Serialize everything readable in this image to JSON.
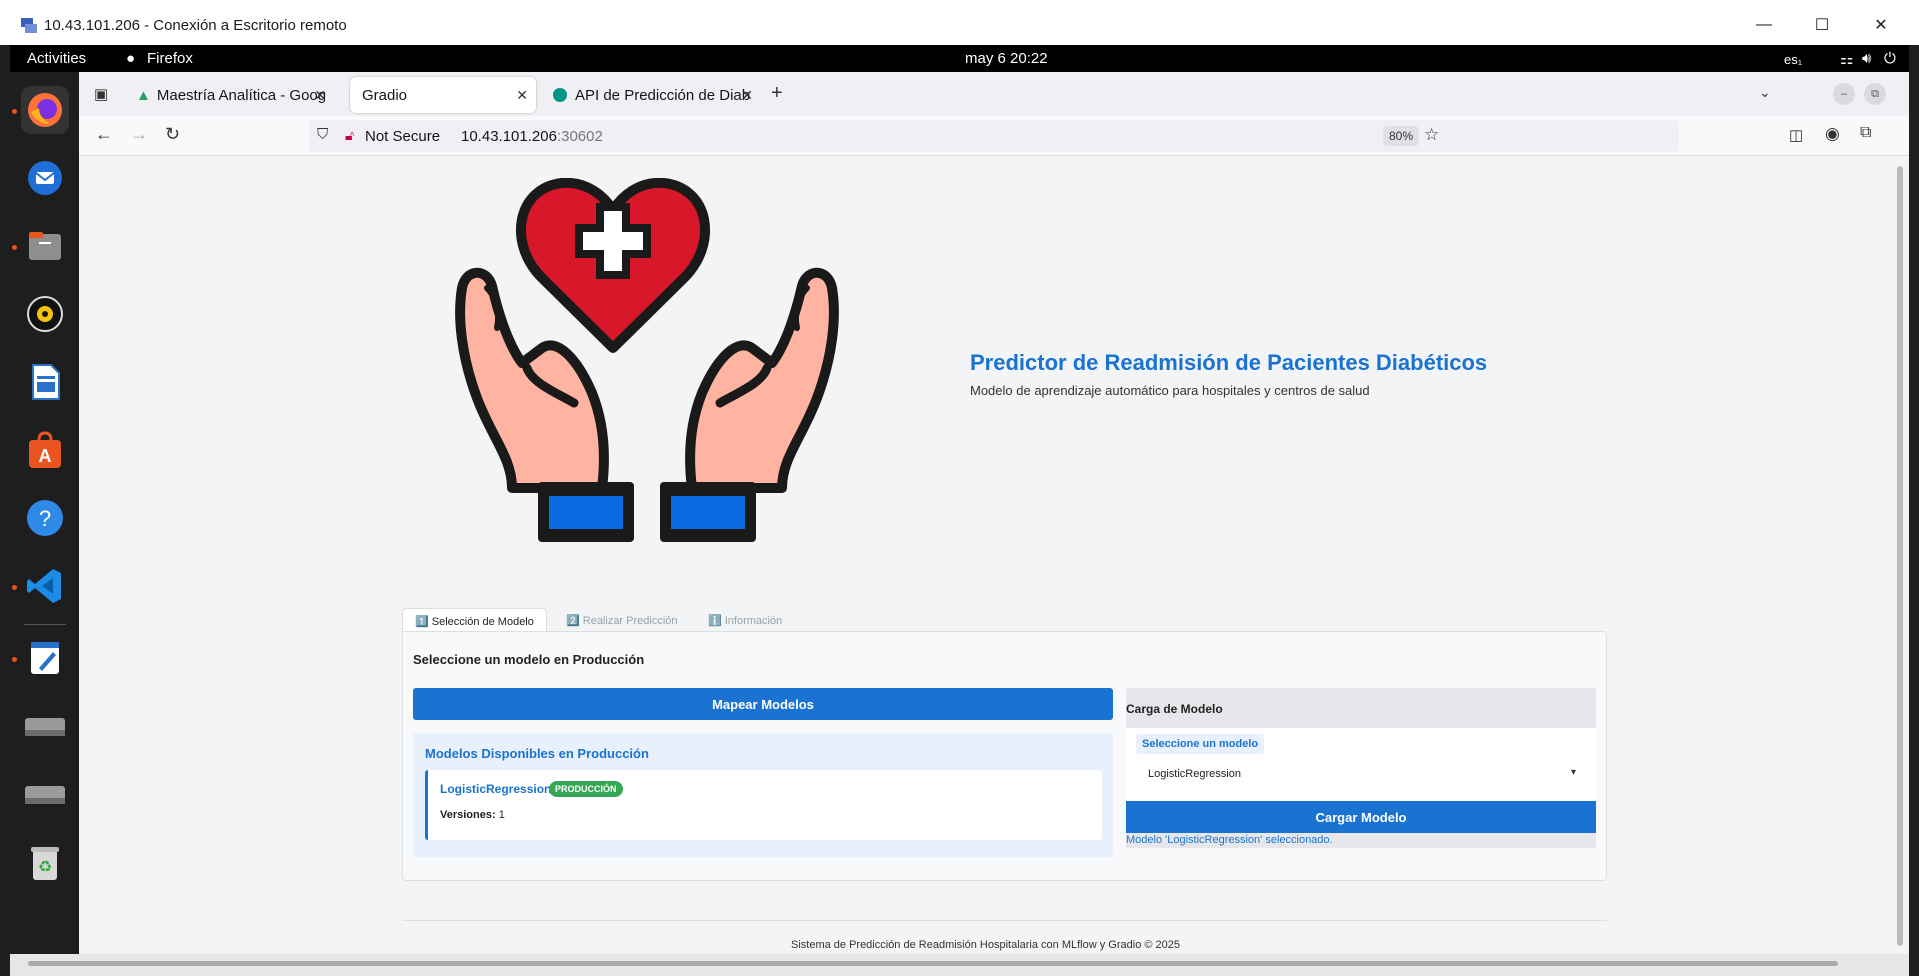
{
  "rdp": {
    "title": "10.43.101.206 - Conexión a Escritorio remoto",
    "minimize": "—",
    "maximize": "☐",
    "close": "✕"
  },
  "gnome": {
    "activities": "Activities",
    "app": "Firefox",
    "clock": "may 6  20:22",
    "lang": "es₁"
  },
  "dock": {
    "items": [
      "firefox-icon",
      "thunderbird-icon",
      "files-icon",
      "rhythmbox-icon",
      "libreoffice-writer-icon",
      "app-center-icon",
      "help-icon",
      "vscode-icon",
      "text-editor-icon",
      "drive-icon",
      "drive-icon",
      "trash-icon"
    ]
  },
  "browser": {
    "tabs": [
      {
        "label": "Maestría Analítica - Goog",
        "icon": "google-drive-icon"
      },
      {
        "label": "Gradio",
        "icon": ""
      },
      {
        "label": "API de Predicción de Diab",
        "icon": "fastapi-icon"
      }
    ],
    "new_tab": "+",
    "security": "Not Secure",
    "url_host": "10.43.101.206",
    "url_port": ":30602",
    "zoom": "80%"
  },
  "header": {
    "title": "Predictor de Readmisión de Pacientes Diabéticos",
    "subtitle": "Modelo de aprendizaje automático para hospitales y centros de salud",
    "logo": "heart-hands-logo"
  },
  "tabs": [
    "1️⃣ Selección de Modelo",
    "2️⃣ Realizar Predicción",
    "ℹ️ Información"
  ],
  "selection": {
    "heading": "Seleccione un modelo en Producción",
    "map_button": "Mapear Modelos",
    "available_title": "Modelos Disponibles en Producción",
    "model_name": "LogisticRegression",
    "badge": "PRODUCCIÓN",
    "versions_label": "Versiones:",
    "versions_value": "1"
  },
  "load": {
    "title": "Carga de Modelo",
    "select_label": "Seleccione un modelo",
    "select_value": "LogisticRegression",
    "button": "Cargar Modelo",
    "status": "Modelo 'LogisticRegression' seleccionado."
  },
  "footer": "Sistema de Predicción de Readmisión Hospitalaria con MLflow y Gradio © 2025",
  "colors": {
    "accent": "#1a73d1",
    "badge": "#34a853",
    "heart": "#d9172b"
  }
}
